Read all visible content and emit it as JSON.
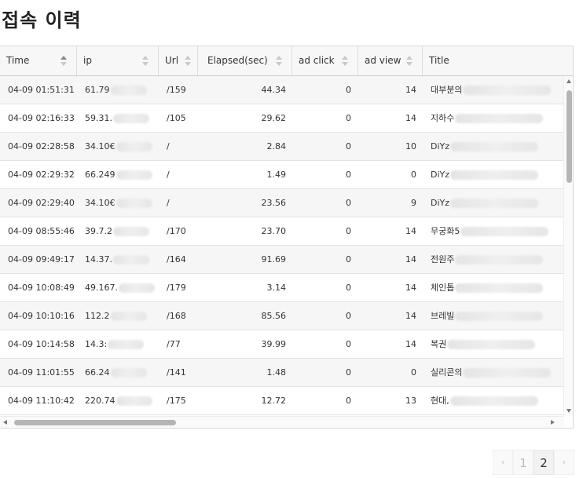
{
  "page": {
    "title": "접속 이력"
  },
  "table": {
    "columns": [
      {
        "key": "time",
        "label": "Time",
        "sort": "asc"
      },
      {
        "key": "ip",
        "label": "ip",
        "sort": "none"
      },
      {
        "key": "url",
        "label": "Url",
        "sort": "none"
      },
      {
        "key": "elapsed",
        "label": "Elapsed(sec)",
        "sort": "none"
      },
      {
        "key": "ad_click",
        "label": "ad click",
        "sort": "none"
      },
      {
        "key": "ad_view",
        "label": "ad view",
        "sort": "none"
      },
      {
        "key": "title",
        "label": "Title",
        "sort": "none"
      }
    ],
    "rows": [
      {
        "time": "04-09 01:51:31",
        "ip": "61.79",
        "url": "/159",
        "elapsed": "44.34",
        "ad_click": "0",
        "ad_view": "14",
        "title": "대부분의"
      },
      {
        "time": "04-09 02:16:33",
        "ip": "59.31.",
        "url": "/105",
        "elapsed": "29.62",
        "ad_click": "0",
        "ad_view": "14",
        "title": "지하수"
      },
      {
        "time": "04-09 02:28:58",
        "ip": "34.10€",
        "url": "/",
        "elapsed": "2.84",
        "ad_click": "0",
        "ad_view": "10",
        "title": "DiYz"
      },
      {
        "time": "04-09 02:29:32",
        "ip": "66.249",
        "url": "/",
        "elapsed": "1.49",
        "ad_click": "0",
        "ad_view": "0",
        "title": "DiYz"
      },
      {
        "time": "04-09 02:29:40",
        "ip": "34.10€",
        "url": "/",
        "elapsed": "23.56",
        "ad_click": "0",
        "ad_view": "9",
        "title": "DiYz"
      },
      {
        "time": "04-09 08:55:46",
        "ip": "39.7.2",
        "url": "/170",
        "elapsed": "23.70",
        "ad_click": "0",
        "ad_view": "14",
        "title": "무궁화5"
      },
      {
        "time": "04-09 09:49:17",
        "ip": "14.37.",
        "url": "/164",
        "elapsed": "91.69",
        "ad_click": "0",
        "ad_view": "14",
        "title": "전원주"
      },
      {
        "time": "04-09 10:08:49",
        "ip": "49.167.",
        "url": "/179",
        "elapsed": "3.14",
        "ad_click": "0",
        "ad_view": "14",
        "title": "체인톱"
      },
      {
        "time": "04-09 10:10:16",
        "ip": "112.2",
        "url": "/168",
        "elapsed": "85.56",
        "ad_click": "0",
        "ad_view": "14",
        "title": "브레빌"
      },
      {
        "time": "04-09 10:14:58",
        "ip": "14.3:",
        "url": "/77",
        "elapsed": "39.99",
        "ad_click": "0",
        "ad_view": "14",
        "title": "복권"
      },
      {
        "time": "04-09 11:01:55",
        "ip": "66.24",
        "url": "/141",
        "elapsed": "1.48",
        "ad_click": "0",
        "ad_view": "0",
        "title": "실리콘의"
      },
      {
        "time": "04-09 11:10:42",
        "ip": "220.74",
        "url": "/175",
        "elapsed": "12.72",
        "ad_click": "0",
        "ad_view": "13",
        "title": "현대,"
      }
    ]
  },
  "pagination": {
    "prev": "‹",
    "pages": [
      "1",
      "2"
    ],
    "current": "2",
    "next": "›"
  }
}
